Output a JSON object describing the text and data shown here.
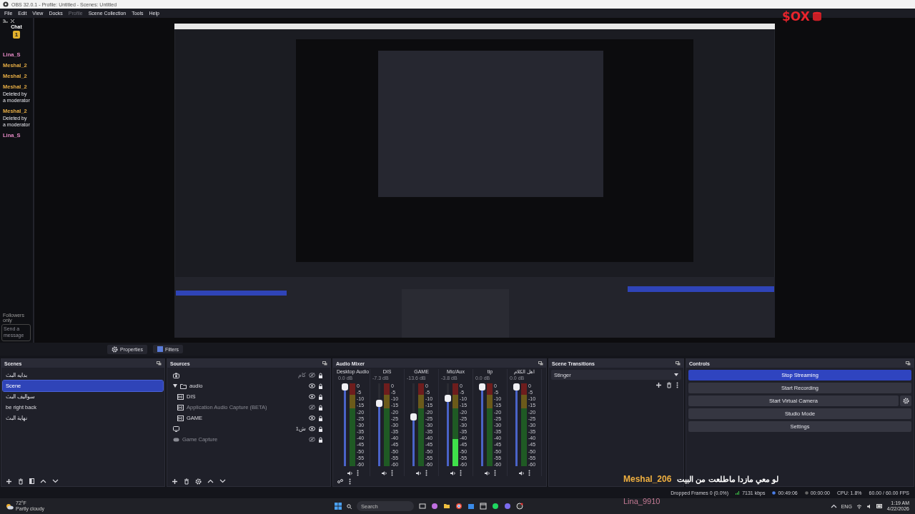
{
  "window": {
    "title": "OBS 32.0.1 - Profile: Untitled - Scenes: Untitled"
  },
  "menu": [
    {
      "label": "File",
      "disabled": false
    },
    {
      "label": "Edit",
      "disabled": false
    },
    {
      "label": "View",
      "disabled": false
    },
    {
      "label": "Docks",
      "disabled": false
    },
    {
      "label": "Profile",
      "disabled": true
    },
    {
      "label": "Scene Collection",
      "disabled": false
    },
    {
      "label": "Tools",
      "disabled": false
    },
    {
      "label": "Help",
      "disabled": false
    }
  ],
  "chat": {
    "title": "Chat",
    "badge": "1",
    "messages": [
      {
        "user": "Lina_S",
        "color": "#e58ac6"
      },
      {
        "user": "Meshal_2",
        "color": "#e6ad45"
      },
      {
        "user": "Meshal_2",
        "color": "#e6ad45"
      },
      {
        "user": "Meshal_2",
        "color": "#e6ad45",
        "text": "Deleted by a moderator"
      },
      {
        "user": "Meshal_2",
        "color": "#e6ad45",
        "text": "Deleted by a moderator"
      },
      {
        "user": "Lina_S",
        "color": "#e58ac6"
      }
    ],
    "mode": "Followers only",
    "input": {
      "placeholder": "Send a message"
    }
  },
  "preview_bar": {
    "buttons": [
      "Properties",
      "Filters"
    ]
  },
  "scenes": {
    "title": "Scenes",
    "items": [
      {
        "label": "بدايه البث",
        "selected": false
      },
      {
        "label": "Scene",
        "selected": true
      },
      {
        "label": "سواليف البث",
        "selected": false
      },
      {
        "label": "be right back",
        "selected": false
      },
      {
        "label": "نهاية البث",
        "selected": false
      }
    ]
  },
  "sources": {
    "title": "Sources",
    "items": [
      {
        "kind": "camera",
        "label": "كام",
        "visible": false
      },
      {
        "kind": "group",
        "label": "audio",
        "visible": true,
        "expanded": true,
        "children": [
          {
            "kind": "audio",
            "label": "DIS",
            "visible": true
          },
          {
            "kind": "audio",
            "label": "Application Audio Capture (BETA)",
            "visible": false
          },
          {
            "kind": "audio",
            "label": "GAME",
            "visible": true
          }
        ]
      },
      {
        "kind": "display",
        "label": "ش1",
        "visible": true
      },
      {
        "kind": "game",
        "label": "Game Capture",
        "visible": false
      }
    ]
  },
  "audio_mixer": {
    "title": "Audio Mixer",
    "channels": [
      {
        "name": "Desktop Audio",
        "reading": "0.0 dB",
        "level": 1,
        "meter": {
          "level": 0
        },
        "scale": [
          "0",
          "-5",
          "-10",
          "-15",
          "-20",
          "-25",
          "-30",
          "-35",
          "-40",
          "-45",
          "-50",
          "-55",
          "-60"
        ]
      },
      {
        "name": "DIS",
        "reading": "-7.3 dB",
        "level": 0.78,
        "meter": {
          "level": 0
        },
        "scale": [
          "0",
          "-5",
          "-10",
          "-15",
          "-20",
          "-25",
          "-30",
          "-35",
          "-40",
          "-45",
          "-50",
          "-55",
          "-60"
        ]
      },
      {
        "name": "GAME",
        "reading": "-13.6 dB",
        "level": 0.6,
        "meter": {
          "level": 0
        },
        "scale": [
          "0",
          "-5",
          "-10",
          "-15",
          "-20",
          "-25",
          "-30",
          "-35",
          "-40",
          "-45",
          "-50",
          "-55",
          "-60"
        ]
      },
      {
        "name": "Mic/Aux",
        "reading": "-3.8 dB",
        "level": 0.85,
        "meter": {
          "level": 0.33
        },
        "scale": [
          "0",
          "-5",
          "-10",
          "-15",
          "-20",
          "-25",
          "-30",
          "-35",
          "-40",
          "-45",
          "-50",
          "-55",
          "-60"
        ]
      },
      {
        "name": "tip",
        "reading": "0.0 dB",
        "level": 1,
        "meter": {
          "level": 0
        },
        "scale": [
          "0",
          "-5",
          "-10",
          "-15",
          "-20",
          "-25",
          "-30",
          "-35",
          "-40",
          "-45",
          "-50",
          "-55",
          "-60"
        ]
      },
      {
        "name": "اهل الكلام",
        "reading": "0.0 dB",
        "level": 1,
        "meter": {
          "level": 0
        },
        "scale": [
          "0",
          "-5",
          "-10",
          "-15",
          "-20",
          "-25",
          "-30",
          "-35",
          "-40",
          "-45",
          "-50",
          "-55",
          "-60"
        ]
      }
    ]
  },
  "transitions": {
    "title": "Scene Transitions",
    "value": "Stinger"
  },
  "controls": {
    "title": "Controls",
    "buttons": [
      {
        "label": "Stop Streaming",
        "active": true,
        "kind": "plain"
      },
      {
        "label": "Start Recording",
        "active": false,
        "kind": "plain"
      },
      {
        "label": "Start Virtual Camera",
        "active": false,
        "kind": "with-settings"
      },
      {
        "label": "Studio Mode",
        "active": false,
        "kind": "plain"
      },
      {
        "label": "Settings",
        "active": false,
        "kind": "plain"
      }
    ]
  },
  "status_bar": {
    "dropped": "Dropped Frames 0 (0.0%)",
    "bitrate": "7131 kbps",
    "stream_time": "00:49:06",
    "record_time": "00:00:00",
    "cpu": "CPU: 1.8%",
    "fps": "60.00 / 60.00 FPS"
  },
  "taskbar": {
    "temperature": "72°F",
    "weather": "Partly cloudy",
    "search": {
      "placeholder": "Search"
    },
    "language": "ENG",
    "time": "1:19 AM",
    "date": "4/22/2026"
  },
  "overlay": {
    "logo": "$OX",
    "chat": [
      {
        "user": "Meshal_206",
        "text": "لو معي مازدا ماطلعت من البيت"
      },
      {
        "user": "Lina_9910"
      }
    ]
  }
}
